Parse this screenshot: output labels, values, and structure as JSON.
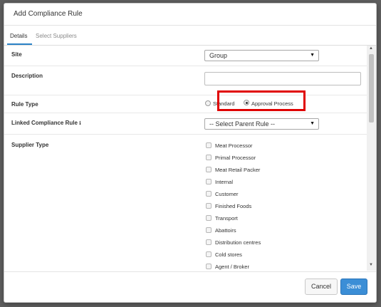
{
  "modal": {
    "title": "Add Compliance Rule"
  },
  "tabs": [
    {
      "label": "Details"
    },
    {
      "label": "Select Suppliers"
    }
  ],
  "form": {
    "site": {
      "label": "Site",
      "value": "Group"
    },
    "description": {
      "label": "Description",
      "value": ""
    },
    "rule_type": {
      "label": "Rule Type",
      "options": [
        {
          "label": "Standard",
          "checked": false
        },
        {
          "label": "Approval Process",
          "checked": true
        }
      ]
    },
    "linked_rule": {
      "label": "Linked Compliance Rule",
      "value": "-- Select Parent Rule --"
    },
    "supplier_type": {
      "label": "Supplier Type",
      "options": [
        {
          "label": "Meat Processor"
        },
        {
          "label": "Primal Processor"
        },
        {
          "label": "Meat Retail Packer"
        },
        {
          "label": "Internal"
        },
        {
          "label": "Customer"
        },
        {
          "label": "Finished Foods"
        },
        {
          "label": "Transport"
        },
        {
          "label": "Abattoirs"
        },
        {
          "label": "Distribution centres"
        },
        {
          "label": "Cold stores"
        },
        {
          "label": "Agent / Broker"
        }
      ]
    }
  },
  "footer": {
    "cancel_label": "Cancel",
    "save_label": "Save"
  },
  "icons": {
    "caret": "caret-down-icon",
    "info": "info-circle-icon"
  },
  "colors": {
    "primary": "#3b8ed6",
    "highlight": "#e00000"
  }
}
